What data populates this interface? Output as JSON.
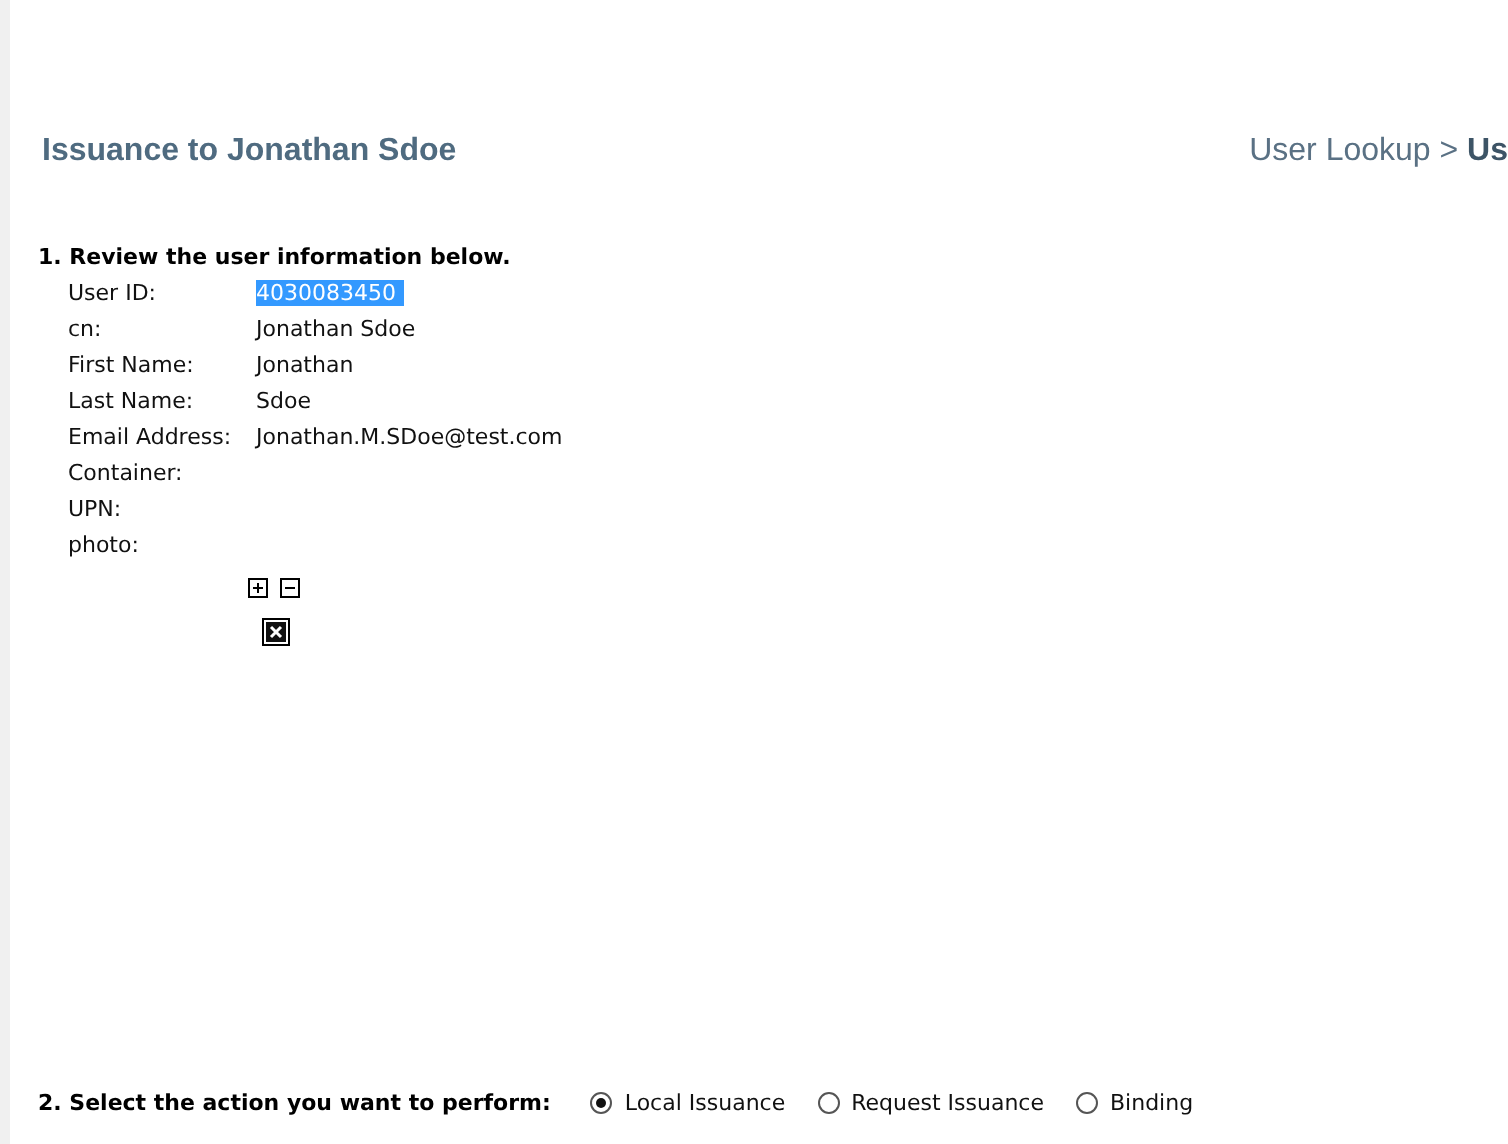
{
  "header": {
    "title": "Issuance to Jonathan Sdoe",
    "breadcrumb": "User Lookup > **Us**"
  },
  "review": {
    "heading": "1. Review the user information below.",
    "fields": [
      {
        "label": "User ID:",
        "value": "4030083450",
        "highlighted": true
      },
      {
        "label": "cn:",
        "value": "Jonathan Sdoe"
      },
      {
        "label": "First Name:",
        "value": "Jonathan"
      },
      {
        "label": "Last Name:",
        "value": "Sdoe"
      },
      {
        "label": "Email Address:",
        "value": "Jonathan.M.SDoe@test.com"
      },
      {
        "label": "Container:"
      },
      {
        "label": "UPN:"
      },
      {
        "label": "photo:"
      }
    ]
  },
  "action": {
    "heading": "2. Select the action you want to perform:",
    "options": [
      {
        "label": "Local Issuance",
        "selected": true
      },
      {
        "label": "Request Issuance",
        "selected": false
      },
      {
        "label": "Binding",
        "selected": false
      }
    ]
  }
}
